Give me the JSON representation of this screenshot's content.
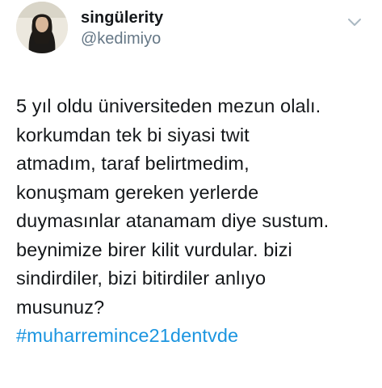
{
  "tweet": {
    "author": {
      "display_name": "singülerity",
      "handle": "@kedimiyo",
      "avatar_icon": "profile-photo"
    },
    "menu_icon": "chevron-down-icon",
    "text_lines": [
      "5 yıl oldu üniversiteden mezun olalı.",
      "korkumdan tek bi siyasi twit",
      "atmadım, taraf belirtmedim,",
      "konuşmam gereken yerlerde",
      "duymasınlar atanamam diye sustum.",
      "beynimize birer kilit vurdular. bizi",
      "sindirdiler, bizi bitirdiler anlıyo",
      "musunuz?"
    ],
    "hashtag": "#muharremince21dentvde"
  },
  "colors": {
    "text": "#14171a",
    "secondary": "#657786",
    "link": "#1b95e0",
    "chevron": "#aab8c2"
  }
}
